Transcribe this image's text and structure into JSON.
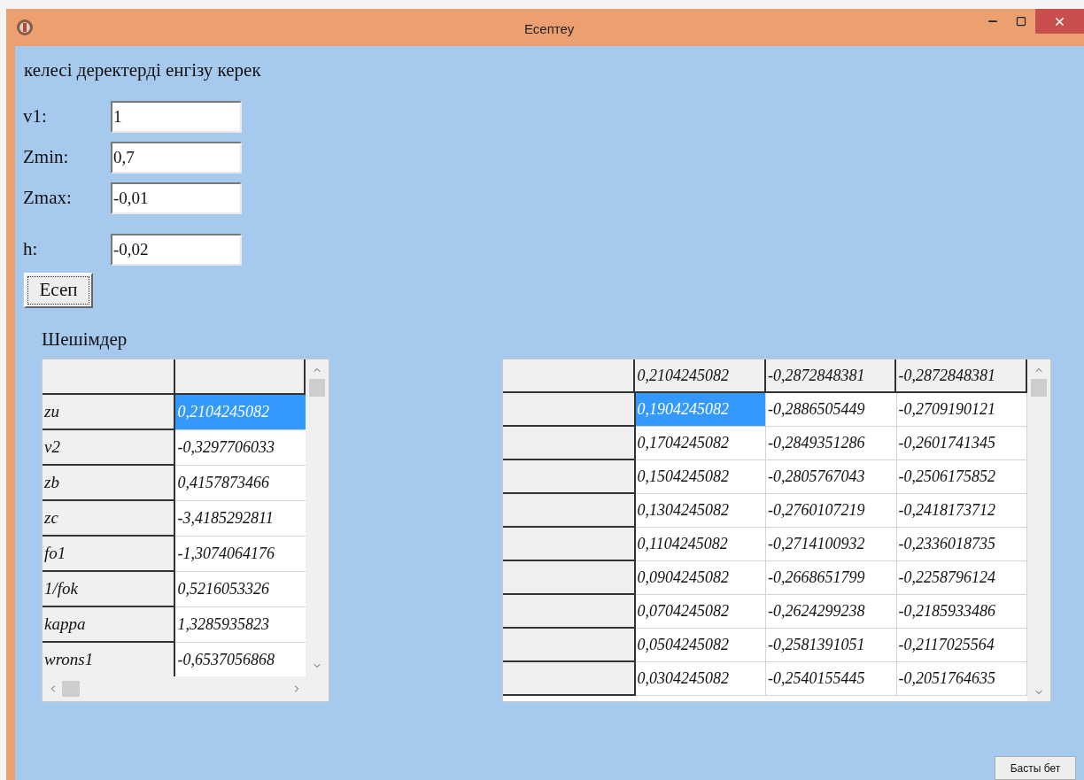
{
  "window": {
    "title": "Есептеу"
  },
  "prompt": "келесі деректерді енгізу керек",
  "fields": [
    {
      "label": "v1:",
      "value": "1"
    },
    {
      "label": "Zmin:",
      "value": "0,7"
    },
    {
      "label": "Zmax:",
      "value": "-0,01"
    },
    {
      "label": "h:",
      "value": "-0,02"
    }
  ],
  "compute_button": "Есеп",
  "results_title": "Шешімдер",
  "results_table": {
    "rows": [
      {
        "label": "zu",
        "value": "0,2104245082",
        "selected": true
      },
      {
        "label": "v2",
        "value": "-0,3297706033",
        "selected": false
      },
      {
        "label": "zb",
        "value": "0,4157873466",
        "selected": false
      },
      {
        "label": "zc",
        "value": "-3,4185292811",
        "selected": false
      },
      {
        "label": "fo1",
        "value": "-1,3074064176",
        "selected": false
      },
      {
        "label": "1/fok",
        "value": "0,5216053326",
        "selected": false
      },
      {
        "label": "kappa",
        "value": "1,3285935823",
        "selected": false
      },
      {
        "label": "wrons1",
        "value": "-0,6537056868",
        "selected": false
      }
    ]
  },
  "series_table": {
    "header": [
      "0,2104245082",
      "-0,2872848381",
      "-0,2872848381"
    ],
    "rows": [
      {
        "cells": [
          {
            "text": "0,1904245082",
            "selected": true
          },
          {
            "text": "-0,2886505449",
            "selected": false
          },
          {
            "text": "-0,2709190121",
            "selected": false
          }
        ]
      },
      {
        "cells": [
          {
            "text": "0,1704245082",
            "selected": false
          },
          {
            "text": "-0,2849351286",
            "selected": false
          },
          {
            "text": "-0,2601741345",
            "selected": false
          }
        ]
      },
      {
        "cells": [
          {
            "text": "0,1504245082",
            "selected": false
          },
          {
            "text": "-0,2805767043",
            "selected": false
          },
          {
            "text": "-0,2506175852",
            "selected": false
          }
        ]
      },
      {
        "cells": [
          {
            "text": "0,1304245082",
            "selected": false
          },
          {
            "text": "-0,2760107219",
            "selected": false
          },
          {
            "text": "-0,2418173712",
            "selected": false
          }
        ]
      },
      {
        "cells": [
          {
            "text": "0,1104245082",
            "selected": false
          },
          {
            "text": "-0,2714100932",
            "selected": false
          },
          {
            "text": "-0,2336018735",
            "selected": false
          }
        ]
      },
      {
        "cells": [
          {
            "text": "0,0904245082",
            "selected": false
          },
          {
            "text": "-0,2668651799",
            "selected": false
          },
          {
            "text": "-0,2258796124",
            "selected": false
          }
        ]
      },
      {
        "cells": [
          {
            "text": "0,0704245082",
            "selected": false
          },
          {
            "text": "-0,2624299238",
            "selected": false
          },
          {
            "text": "-0,2185933486",
            "selected": false
          }
        ]
      },
      {
        "cells": [
          {
            "text": "0,0504245082",
            "selected": false
          },
          {
            "text": "-0,2581391051",
            "selected": false
          },
          {
            "text": "-0,2117025564",
            "selected": false
          }
        ]
      },
      {
        "cells": [
          {
            "text": "0,0304245082",
            "selected": false
          },
          {
            "text": "-0,2540155445",
            "selected": false
          },
          {
            "text": "-0,2051764635",
            "selected": false
          }
        ]
      }
    ]
  },
  "home_button": "Басты бет"
}
